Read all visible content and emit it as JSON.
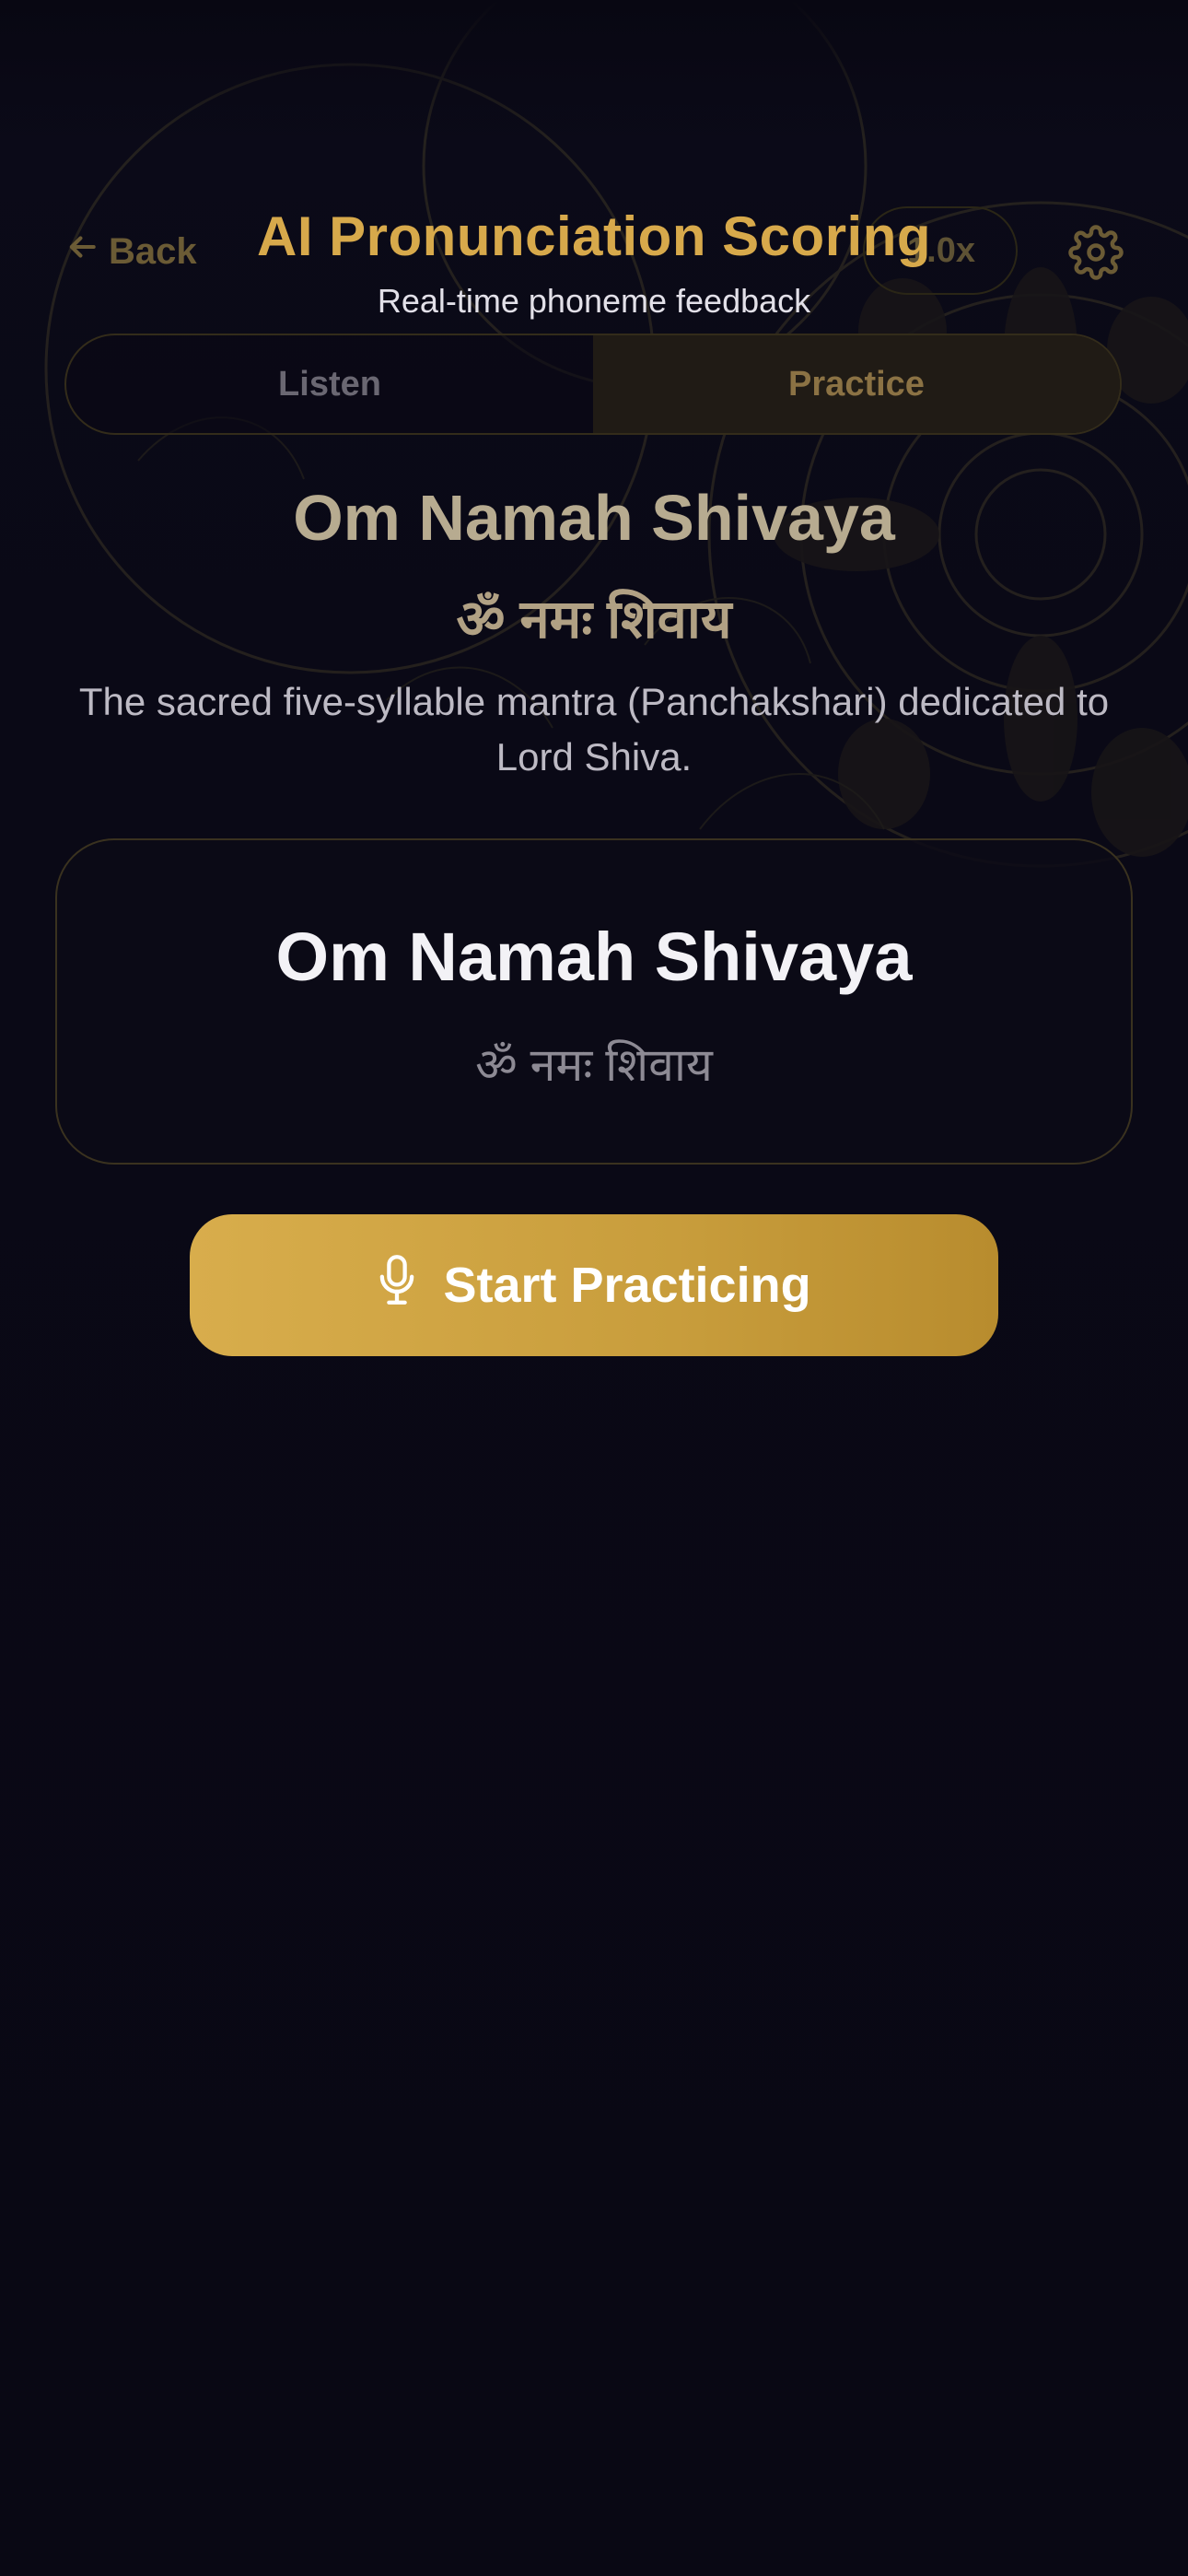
{
  "header": {
    "back_label": "Back",
    "title": "AI Pronunciation Scoring",
    "subtitle": "Real-time phoneme feedback",
    "speed_label": "1.0x"
  },
  "tabs": [
    {
      "label": "Listen",
      "active": false
    },
    {
      "label": "Practice",
      "active": true
    }
  ],
  "mantra": {
    "title": "Om Namah Shivaya",
    "devanagari": "ॐ नमः शिवाय",
    "description": "The sacred five-syllable mantra (Panchakshari) dedicated to Lord Shiva."
  },
  "card": {
    "title": "Om Namah Shivaya",
    "devanagari": "ॐ नमः शिवाय"
  },
  "action": {
    "start_label": "Start Practicing"
  },
  "colors": {
    "background": "#090814",
    "accent_gold": "#d7a94b",
    "button_gold": "#c89d3c"
  },
  "icons": {
    "back": "arrow-left-icon",
    "settings": "gear-icon",
    "microphone": "microphone-icon"
  }
}
